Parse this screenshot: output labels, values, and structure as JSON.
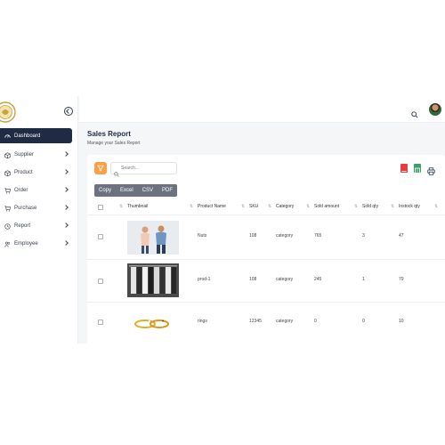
{
  "sidebar": {
    "items": [
      {
        "label": "Dashboard",
        "icon": "dashboard-icon",
        "active": true
      },
      {
        "label": "Supplier",
        "icon": "box-icon"
      },
      {
        "label": "Product",
        "icon": "box-icon"
      },
      {
        "label": "Order",
        "icon": "cart-icon"
      },
      {
        "label": "Purchase",
        "icon": "cart-icon"
      },
      {
        "label": "Report",
        "icon": "clock-icon"
      },
      {
        "label": "Employee",
        "icon": "users-icon"
      }
    ]
  },
  "header": {
    "search_icon": "search-icon",
    "avatar": "user-avatar"
  },
  "page": {
    "title": "Sales Report",
    "subtitle": "Manage your Sales Report"
  },
  "toolbar": {
    "search_placeholder": "Search...",
    "export_buttons": [
      "Copy",
      "Excel",
      "CSV",
      "PDF"
    ],
    "filter_color": "#f7a24a",
    "pdf_color": "#e53e3e",
    "excel_color": "#38a169"
  },
  "table": {
    "columns": [
      "Thumbnail",
      "Product Name",
      "SKU",
      "Category",
      "Sold amount",
      "Sold qty",
      "Instock qty"
    ],
    "rows": [
      {
        "thumbnail": "people-photo",
        "name": "Nuts",
        "sku": "108",
        "category": "category",
        "sold_amount": "765",
        "sold_qty": "3",
        "instock_qty": "47"
      },
      {
        "thumbnail": "clothes-rack-photo",
        "name": "prod-1",
        "sku": "108",
        "category": "category",
        "sold_amount": "245",
        "sold_qty": "1",
        "instock_qty": "79"
      },
      {
        "thumbnail": "rings-photo",
        "name": "rings",
        "sku": "12345",
        "category": "category",
        "sold_amount": "0",
        "sold_qty": "0",
        "instock_qty": "10"
      }
    ]
  },
  "colors": {
    "sidebar_active": "#1f2a44",
    "export_group": "#6c7280"
  }
}
